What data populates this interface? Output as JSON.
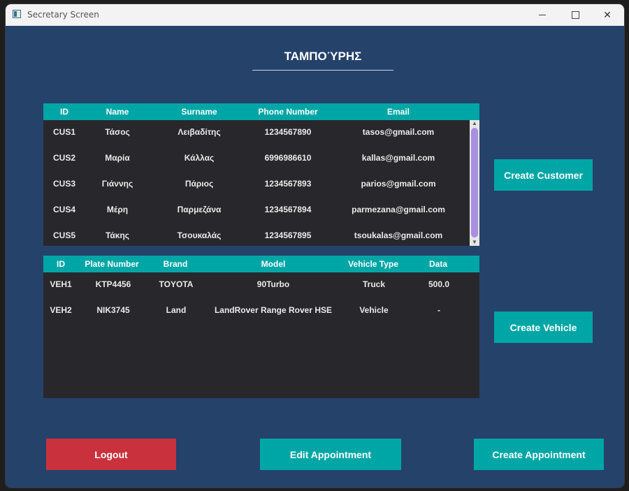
{
  "window": {
    "title": "Secretary Screen",
    "minimize_glyph": "",
    "close_glyph": "✕"
  },
  "heading": "ΤΑΜΠΟΎΡΗΣ",
  "customers": {
    "columns": [
      "ID",
      "Name",
      "Surname",
      "Phone Number",
      "Email"
    ],
    "rows": [
      [
        "CUS1",
        "Τάσος",
        "Λειβαδίτης",
        "1234567890",
        "tasos@gmail.com"
      ],
      [
        "CUS2",
        "Μαρία",
        "Κάλλας",
        "6996986610",
        "kallas@gmail.com"
      ],
      [
        "CUS3",
        "Γιάννης",
        "Πάριος",
        "1234567893",
        "parios@gmail.com"
      ],
      [
        "CUS4",
        "Μέρη",
        "Παρμεζάνα",
        "1234567894",
        "parmezana@gmail.com"
      ],
      [
        "CUS5",
        "Τάκης",
        "Τσουκαλάς",
        "1234567895",
        "tsoukalas@gmail.com"
      ]
    ]
  },
  "vehicles": {
    "columns": [
      "ID",
      "Plate Number",
      "Brand",
      "Model",
      "Vehicle Type",
      "Data"
    ],
    "rows": [
      [
        "VEH1",
        "KTP4456",
        "TOYOTA",
        "90Turbo",
        "Truck",
        "500.0"
      ],
      [
        "VEH2",
        "NIK3745",
        "Land",
        "LandRover Range Rover HSE",
        "Vehicle",
        "-"
      ]
    ]
  },
  "buttons": {
    "create_customer": "Create Customer",
    "create_vehicle": "Create Vehicle",
    "logout": "Logout",
    "edit_appointment": "Edit Appointment",
    "create_appointment": "Create Appointment"
  },
  "colors": {
    "background": "#25426b",
    "accent": "#00a6a6",
    "danger": "#c9313d",
    "table_bg": "#28282c"
  },
  "icons": {
    "app": "app-icon",
    "minimize": "minimize-icon",
    "maximize": "maximize-icon",
    "close": "close-icon"
  }
}
